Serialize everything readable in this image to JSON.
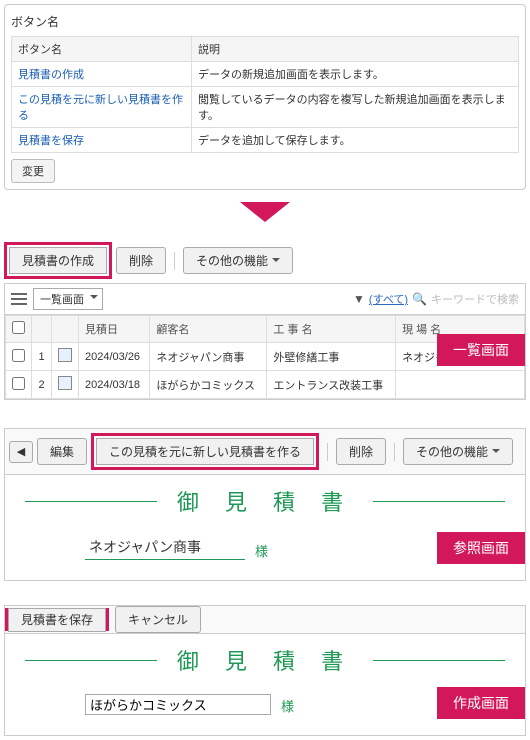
{
  "config": {
    "panel_title": "ボタン名",
    "header_name": "ボタン名",
    "header_desc": "説明",
    "rows": [
      {
        "name": "見積書の作成",
        "desc": "データの新規追加画面を表示します。"
      },
      {
        "name": "この見積を元に新しい見積書を作る",
        "desc": "閲覧しているデータの内容を複写した新規追加画面を表示します。"
      },
      {
        "name": "見積書を保存",
        "desc": "データを追加して保存します。"
      }
    ],
    "change_btn": "変更"
  },
  "list": {
    "create_btn": "見積書の作成",
    "delete_btn": "削除",
    "other_btn": "その他の機能",
    "view_select": "一覧画面",
    "filter_all": "(すべて)",
    "search_ph": "キーワードで検索",
    "col_date": "見積日",
    "col_customer": "顧客名",
    "col_work": "工 事 名",
    "col_site": "現 場 名",
    "rows": [
      {
        "n": "1",
        "date": "2024/03/26",
        "customer": "ネオジャパン商事",
        "work": "外壁修繕工事",
        "site": "ネオジャパン商事本社"
      },
      {
        "n": "2",
        "date": "2024/03/18",
        "customer": "ほがらかコミックス",
        "work": "エントランス改装工事",
        "site": ""
      }
    ],
    "label": "一覧画面"
  },
  "ref": {
    "back_icon": "◀",
    "edit_btn": "編集",
    "copy_btn": "この見積を元に新しい見積書を作る",
    "delete_btn": "削除",
    "other_btn": "その他の機能",
    "title": "御 見 積 書",
    "client": "ネオジャパン商事",
    "suffix": "様",
    "label": "参照画面"
  },
  "create": {
    "save_btn": "見積書を保存",
    "cancel_btn": "キャンセル",
    "title": "御 見 積 書",
    "client": "ほがらかコミックス",
    "suffix": "様",
    "label": "作成画面"
  }
}
